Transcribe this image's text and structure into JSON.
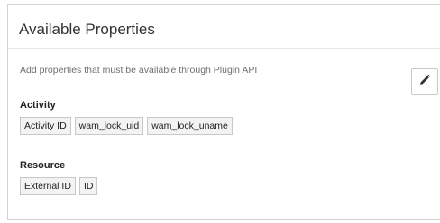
{
  "panel": {
    "title": "Available Properties",
    "description": "Add properties that must be available through Plugin API",
    "edit_icon": "pencil-icon"
  },
  "groups": [
    {
      "label": "Activity",
      "chips": [
        "Activity ID",
        "wam_lock_uid",
        "wam_lock_uname"
      ]
    },
    {
      "label": "Resource",
      "chips": [
        "External ID",
        "ID"
      ]
    }
  ]
}
